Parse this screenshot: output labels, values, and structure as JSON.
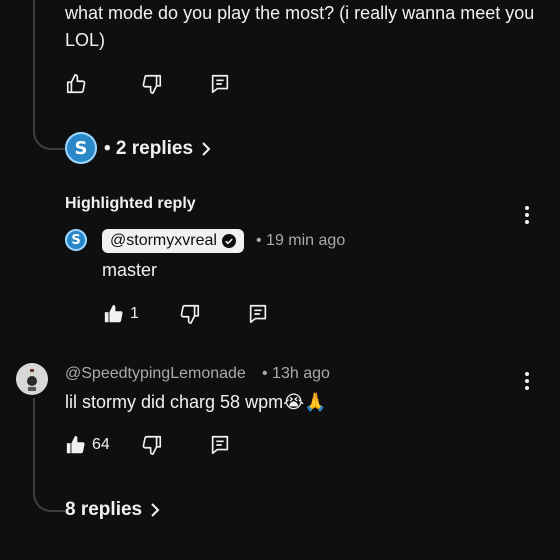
{
  "parent_comment": {
    "text": "what mode do you play the most? (i really wanna meet you LOL)",
    "replies_label": "• 2 replies"
  },
  "highlighted": {
    "section_label": "Highlighted reply",
    "handle": "@stormyxvreal",
    "time": "• 19 min ago",
    "text": "master",
    "like_count": "1"
  },
  "comment2": {
    "handle": "@SpeedtypingLemonade",
    "time": "• 13h ago",
    "text": "lil stormy did charg 58 wpm😭🙏",
    "like_count": "64",
    "replies_label": "8 replies"
  },
  "colors": {
    "background": "#0f0f0f",
    "text": "#f1f1f1",
    "muted": "#aaaaaa",
    "thread_line": "#3f3f3f",
    "avatar_blue": "#2a88c8"
  }
}
